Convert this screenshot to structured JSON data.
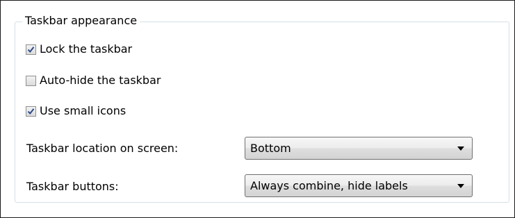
{
  "group": {
    "title": "Taskbar appearance"
  },
  "options": [
    {
      "label": "Lock the taskbar",
      "checked": true
    },
    {
      "label": "Auto-hide the taskbar",
      "checked": false
    },
    {
      "label": "Use small icons",
      "checked": true
    }
  ],
  "location": {
    "label": "Taskbar location on screen:",
    "value": "Bottom"
  },
  "buttons": {
    "label": "Taskbar buttons:",
    "value": "Always combine, hide labels"
  },
  "colors": {
    "check_mark": "#2a4a8a",
    "group_border": "#d5dfe5",
    "combo_border": "#707070"
  },
  "icons": {
    "checkmark": "checkmark-icon",
    "dropdown": "chevron-down-icon"
  }
}
